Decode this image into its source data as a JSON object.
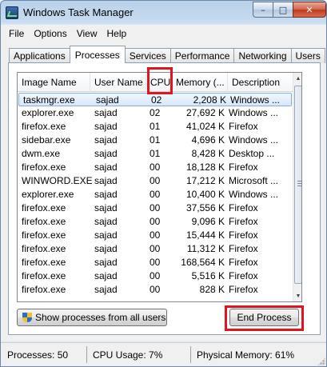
{
  "window": {
    "title": "Windows Task Manager",
    "controls": {
      "minimize": "–",
      "maximize": "□",
      "close": "✕"
    }
  },
  "menu": [
    "File",
    "Options",
    "View",
    "Help"
  ],
  "tabs": [
    "Applications",
    "Processes",
    "Services",
    "Performance",
    "Networking",
    "Users"
  ],
  "active_tab": "Processes",
  "columns": {
    "name": "Image Name",
    "user": "User Name",
    "cpu": "CPU",
    "memory": "Memory (...",
    "description": "Description"
  },
  "processes": [
    {
      "name": "taskmgr.exe",
      "user": "sajad",
      "cpu": "02",
      "memory": "2,208 K",
      "description": "Windows ...",
      "selected": true
    },
    {
      "name": "explorer.exe",
      "user": "sajad",
      "cpu": "02",
      "memory": "27,692 K",
      "description": "Windows ..."
    },
    {
      "name": "firefox.exe",
      "user": "sajad",
      "cpu": "01",
      "memory": "41,024 K",
      "description": "Firefox"
    },
    {
      "name": "sidebar.exe",
      "user": "sajad",
      "cpu": "01",
      "memory": "4,696 K",
      "description": "Windows ..."
    },
    {
      "name": "dwm.exe",
      "user": "sajad",
      "cpu": "01",
      "memory": "8,428 K",
      "description": "Desktop ..."
    },
    {
      "name": "firefox.exe",
      "user": "sajad",
      "cpu": "00",
      "memory": "18,128 K",
      "description": "Firefox"
    },
    {
      "name": "WINWORD.EXE",
      "user": "sajad",
      "cpu": "00",
      "memory": "17,212 K",
      "description": "Microsoft ..."
    },
    {
      "name": "explorer.exe",
      "user": "sajad",
      "cpu": "00",
      "memory": "10,400 K",
      "description": "Windows ..."
    },
    {
      "name": "firefox.exe",
      "user": "sajad",
      "cpu": "00",
      "memory": "37,556 K",
      "description": "Firefox"
    },
    {
      "name": "firefox.exe",
      "user": "sajad",
      "cpu": "00",
      "memory": "9,096 K",
      "description": "Firefox"
    },
    {
      "name": "firefox.exe",
      "user": "sajad",
      "cpu": "00",
      "memory": "15,444 K",
      "description": "Firefox"
    },
    {
      "name": "firefox.exe",
      "user": "sajad",
      "cpu": "00",
      "memory": "11,312 K",
      "description": "Firefox"
    },
    {
      "name": "firefox.exe",
      "user": "sajad",
      "cpu": "00",
      "memory": "168,564 K",
      "description": "Firefox"
    },
    {
      "name": "firefox.exe",
      "user": "sajad",
      "cpu": "00",
      "memory": "5,516 K",
      "description": "Firefox"
    },
    {
      "name": "firefox.exe",
      "user": "sajad",
      "cpu": "00",
      "memory": "828 K",
      "description": "Firefox"
    }
  ],
  "buttons": {
    "show_all": "Show processes from all users",
    "end_process": "End Process"
  },
  "status": {
    "processes": "Processes: 50",
    "cpu_usage": "CPU Usage: 7%",
    "physical_memory": "Physical Memory: 61%"
  },
  "icons": {
    "app": "task-manager-icon",
    "shield": "uac-shield-icon"
  },
  "colors": {
    "highlight": "#e0141e",
    "selection": "#d7e7fb"
  }
}
